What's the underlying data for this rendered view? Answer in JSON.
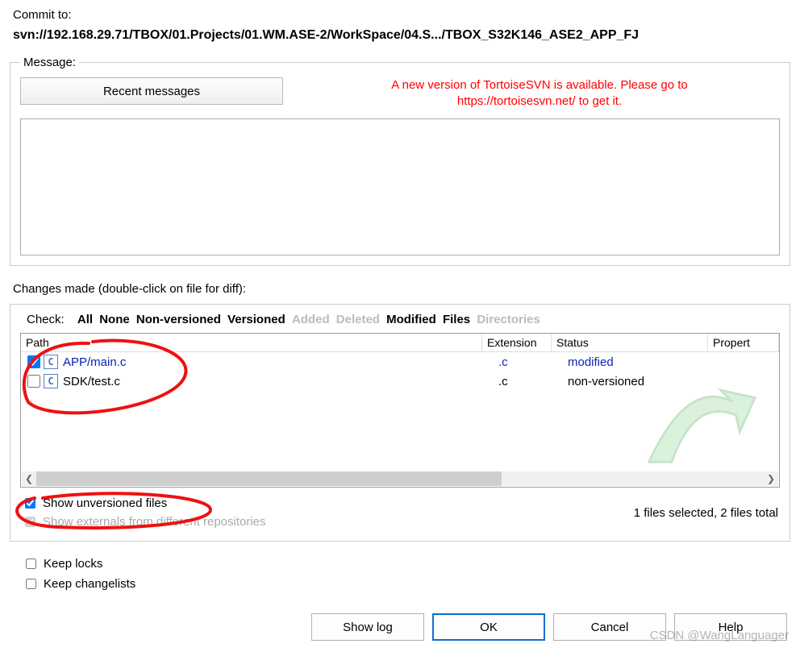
{
  "commit_to_label": "Commit to:",
  "commit_url": "svn://192.168.29.71/TBOX/01.Projects/01.WM.ASE-2/WorkSpace/04.S.../TBOX_S32K146_ASE2_APP_FJ",
  "message": {
    "legend": "Message:",
    "recent_button": "Recent messages",
    "update_notice_l1": "A new version of TortoiseSVN is available. Please go to",
    "update_notice_l2": "https://tortoisesvn.net/ to get it."
  },
  "changes_label": "Changes made (double-click on file for diff):",
  "check_row": {
    "label": "Check:",
    "all": "All",
    "none": "None",
    "nonversioned": "Non-versioned",
    "versioned": "Versioned",
    "added": "Added",
    "deleted": "Deleted",
    "modified": "Modified",
    "files": "Files",
    "directories": "Directories"
  },
  "cols": {
    "path": "Path",
    "extension": "Extension",
    "status": "Status",
    "property": "Propert"
  },
  "files": [
    {
      "checked": true,
      "path": "APP/main.c",
      "ext": ".c",
      "status": "modified",
      "kind": "modified"
    },
    {
      "checked": false,
      "path": "SDK/test.c",
      "ext": ".c",
      "status": "non-versioned",
      "kind": "nonversioned"
    }
  ],
  "show_unversioned": {
    "label": "Show unversioned files",
    "checked": true
  },
  "show_externals": {
    "label": "Show externals from different repositories",
    "checked": true,
    "disabled": true
  },
  "stats": "1 files selected, 2 files total",
  "keep_locks": {
    "label": "Keep locks",
    "checked": false
  },
  "keep_changelists": {
    "label": "Keep changelists",
    "checked": false
  },
  "buttons": {
    "show_log": "Show log",
    "ok": "OK",
    "cancel": "Cancel",
    "help": "Help"
  },
  "watermark": "CSDN @WangLanguager"
}
